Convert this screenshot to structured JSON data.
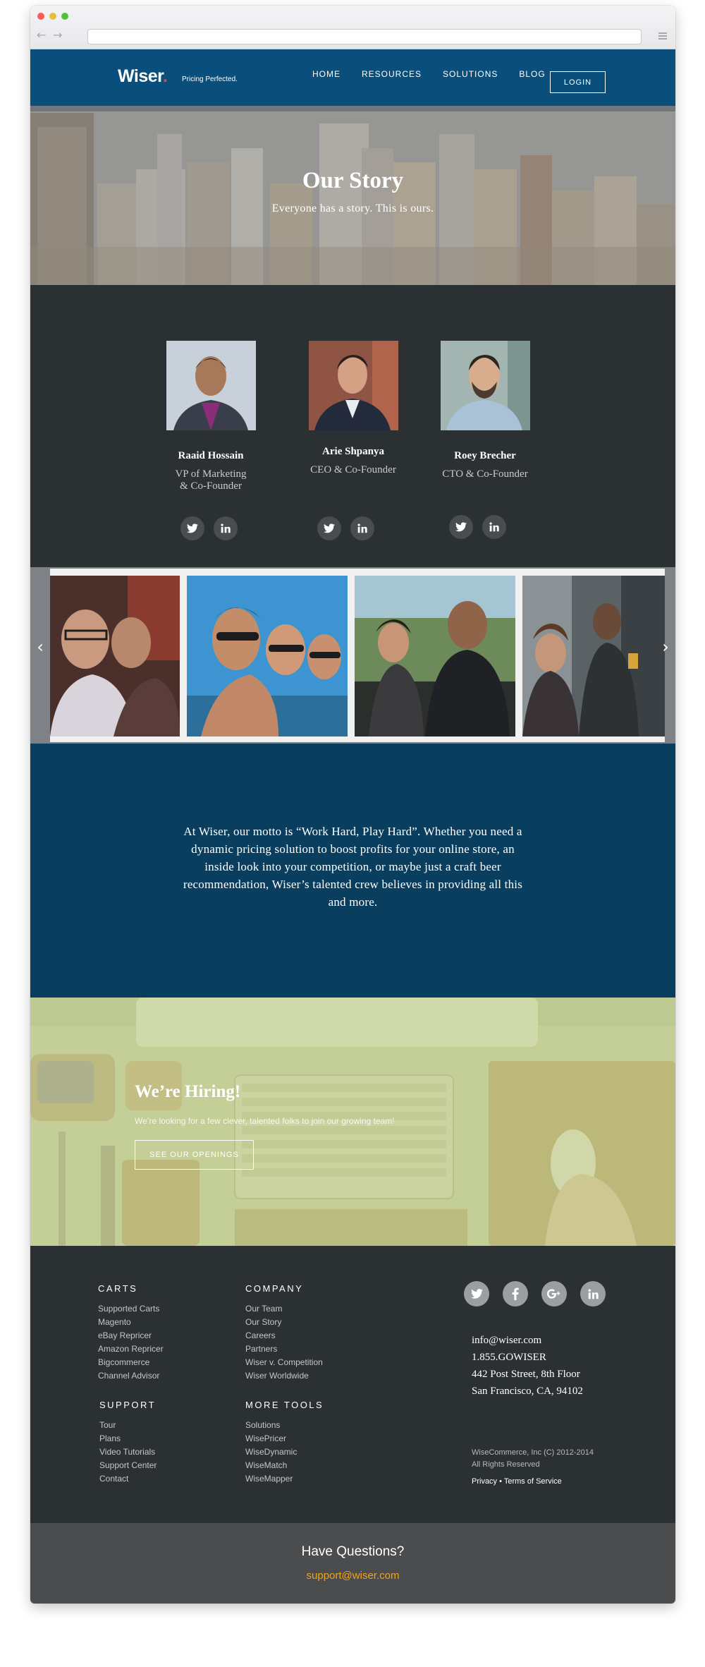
{
  "browser": {
    "back_icon": "←",
    "forward_icon": "→"
  },
  "header": {
    "logo_text": "Wiser",
    "logo_dot": ".",
    "tagline": "Pricing Perfected.",
    "nav": [
      "HOME",
      "RESOURCES",
      "SOLUTIONS",
      "BLOG"
    ],
    "login": "LOGIN"
  },
  "hero": {
    "title": "Our Story",
    "subtitle": "Everyone has a story. This is ours."
  },
  "team": [
    {
      "name": "Raaid Hossain",
      "role_line1": "VP of Marketing",
      "role_line2": "& Co-Founder",
      "socials": [
        "twitter-icon",
        "linkedin-icon"
      ]
    },
    {
      "name": "Arie Shpanya",
      "role_line1": "CEO & Co-Founder",
      "role_line2": "",
      "socials": [
        "twitter-icon",
        "linkedin-icon"
      ]
    },
    {
      "name": "Roey Brecher",
      "role_line1": "CTO & Co-Founder",
      "role_line2": "",
      "socials": [
        "twitter-icon",
        "linkedin-icon"
      ]
    }
  ],
  "gallery": {
    "prev_icon": "‹",
    "next_icon": "›",
    "photo_count": 4
  },
  "motto": {
    "text": "At Wiser, our motto is “Work Hard, Play Hard”. Whether you need a dynamic pricing solution to boost profits for your online store, an inside look into your competition, or maybe just a craft beer recommendation, Wiser’s talented crew believes in providing all this and more."
  },
  "hiring": {
    "title": "We’re Hiring!",
    "subtitle": "We’re looking for a few clever, talented folks to join our growing team!",
    "button": "SEE OUR OPENINGS"
  },
  "footer": {
    "carts": {
      "heading": "CARTS",
      "links": [
        "Supported Carts",
        "Magento",
        "eBay Repricer",
        "Amazon Repricer",
        "Bigcommerce",
        "Channel Advisor"
      ]
    },
    "company": {
      "heading": "COMPANY",
      "links": [
        "Our Team",
        "Our Story",
        "Careers",
        "Partners",
        "Wiser v. Competition",
        "Wiser Worldwide"
      ]
    },
    "support": {
      "heading": "SUPPORT",
      "links": [
        "Tour",
        "Plans",
        "Video Tutorials",
        "Support Center",
        "Contact"
      ]
    },
    "tools": {
      "heading": "MORE TOOLS",
      "links": [
        "Solutions",
        "WisePricer",
        "WiseDynamic",
        "WiseMatch",
        "WiseMapper"
      ]
    },
    "social_icons": [
      "twitter-icon",
      "facebook-icon",
      "google-plus-icon",
      "linkedin-icon"
    ],
    "contact": {
      "email": "info@wiser.com",
      "phone": "1.855.GOWISER",
      "address1": "442 Post Street, 8th Floor",
      "address2": "San Francisco, CA, 94102"
    },
    "legal": {
      "copyright": "WiseCommerce, Inc (C) 2012-2014",
      "rights": "All Rights Reserved",
      "privacy": "Privacy",
      "separator": "•",
      "terms": "Terms of Service"
    }
  },
  "questions": {
    "title": "Have Questions?",
    "email": "support@wiser.com"
  },
  "colors": {
    "header_blue": "#0a4f7c",
    "motto_blue": "#0a3e5e",
    "dark_slate": "#2b3033",
    "hiring_green": "#c6d19a",
    "accent_orange": "#f2a31b",
    "logo_red": "#e8453c"
  }
}
